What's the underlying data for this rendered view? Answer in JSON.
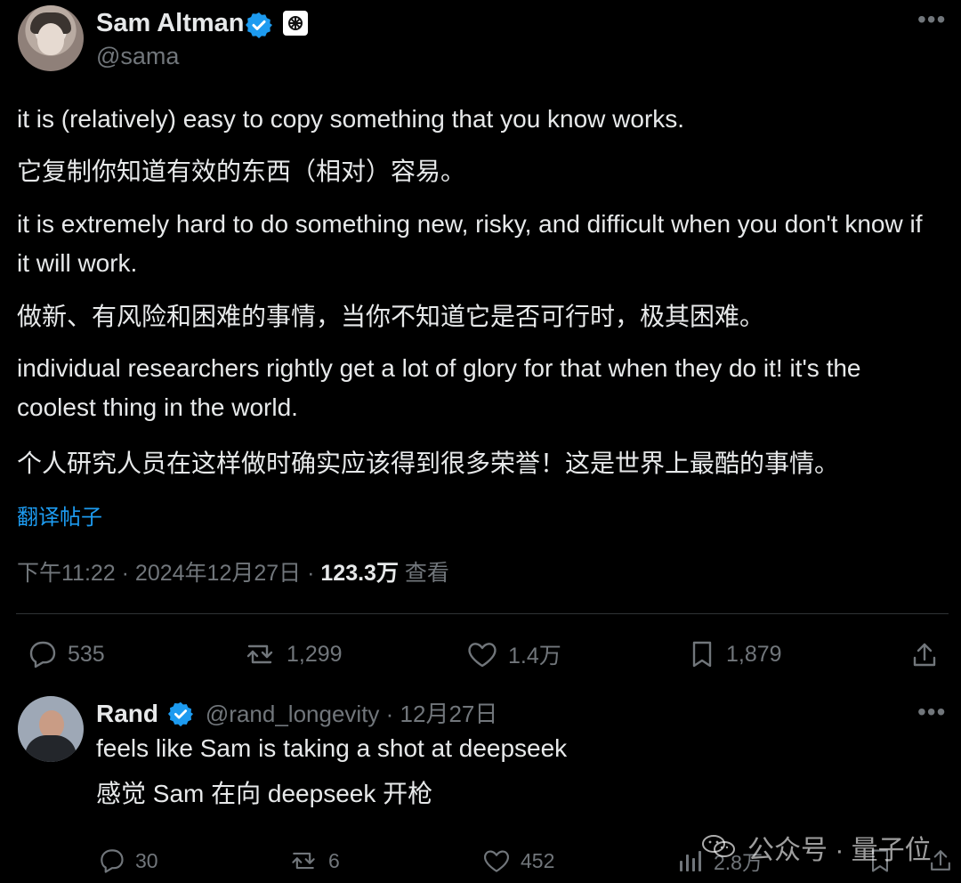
{
  "tweet": {
    "author": {
      "name": "Sam Altman",
      "handle": "@sama"
    },
    "paragraphs": [
      "it is (relatively) easy to copy something that you know works.",
      "它复制你知道有效的东西（相对）容易。",
      "it is extremely hard to do something new, risky, and difficult when you don't know if it will work.",
      "做新、有风险和困难的事情，当你不知道它是否可行时，极其困难。",
      "individual researchers rightly get a lot of glory for that when they do it! it's the coolest thing in the world.",
      "个人研究人员在这样做时确实应该得到很多荣誉！这是世界上最酷的事情。"
    ],
    "translate_label": "翻译帖子",
    "meta": {
      "time": "下午11:22 · 2024年12月27日 ·",
      "views": "123.3万",
      "views_label": "查看"
    },
    "actions": {
      "replies": "535",
      "reposts": "1,299",
      "likes": "1.4万",
      "bookmarks": "1,879"
    }
  },
  "reply": {
    "author": {
      "name": "Rand",
      "handle": "@rand_longevity · 12月27日"
    },
    "text": "feels like Sam is taking a shot at deepseek",
    "translation": "感觉 Sam 在向 deepseek 开枪",
    "actions": {
      "replies": "30",
      "reposts": "6",
      "likes": "452",
      "views": "2.8万"
    }
  },
  "watermark": {
    "text": "公众号 · 量子位"
  },
  "colors": {
    "background": "#000000",
    "text": "#e7e9ea",
    "muted": "#71767b",
    "accent": "#1d9bf0",
    "divider": "#2f3336",
    "verified": "#1d9bf0"
  },
  "icons": {
    "verified": "verified-badge-icon",
    "openai": "openai-logo-icon",
    "more": "more-horizontal-icon",
    "reply": "reply-icon",
    "repost": "repost-icon",
    "like": "heart-icon",
    "bookmark": "bookmark-icon",
    "share": "share-icon",
    "views": "views-icon",
    "wechat": "wechat-icon"
  }
}
